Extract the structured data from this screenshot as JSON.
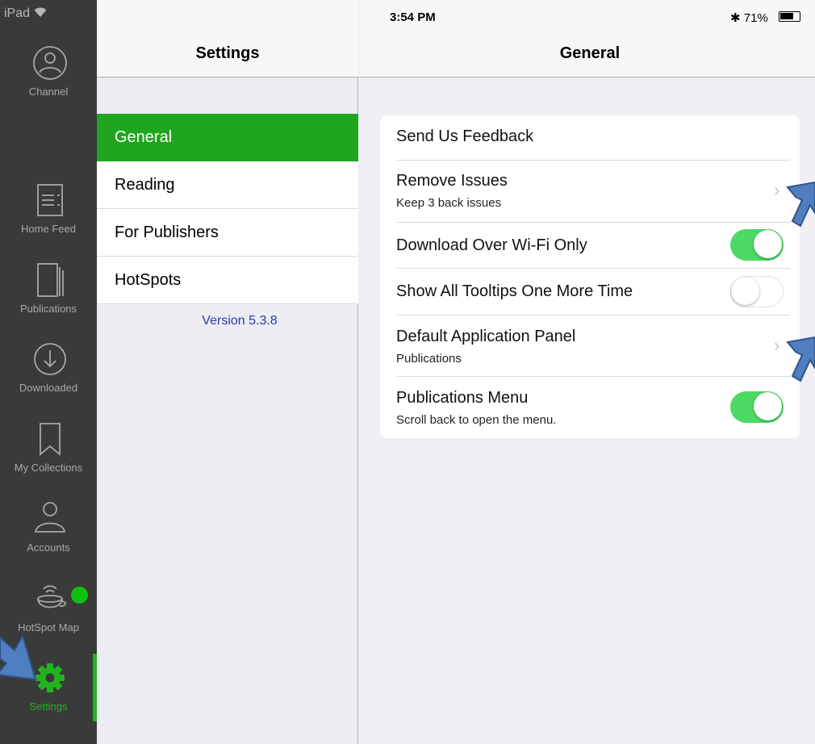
{
  "status_bar": {
    "device": "iPad",
    "time": "3:54 PM",
    "battery": "71%",
    "battery_level": 0.71
  },
  "rail": {
    "items": [
      {
        "label": "Channel",
        "icon": "person-circle-icon"
      },
      {
        "label": "Home Feed",
        "icon": "feed-icon"
      },
      {
        "label": "Publications",
        "icon": "publications-icon"
      },
      {
        "label": "Downloaded",
        "icon": "download-icon"
      },
      {
        "label": "My Collections",
        "icon": "bookmark-icon"
      },
      {
        "label": "Accounts",
        "icon": "person-icon"
      },
      {
        "label": "HotSpot Map",
        "icon": "hotspot-cup-icon"
      },
      {
        "label": "Settings",
        "icon": "gear-icon",
        "active": true
      }
    ],
    "accent": "#22b320"
  },
  "master": {
    "title": "Settings",
    "items": [
      "General",
      "Reading",
      "For Publishers",
      "HotSpots"
    ],
    "selected": "General",
    "version": "Version 5.3.8",
    "selection_color": "#1ea61e"
  },
  "detail": {
    "title": "General",
    "rows": [
      {
        "title": "Send Us Feedback"
      },
      {
        "title": "Remove Issues",
        "subtitle": "Keep 3 back issues",
        "accessory": "chevron"
      },
      {
        "title": "Download Over Wi-Fi Only",
        "toggle": true
      },
      {
        "title": "Show All Tooltips One More Time",
        "toggle": false
      },
      {
        "title": "Default Application Panel",
        "subtitle": "Publications",
        "accessory": "chevron"
      },
      {
        "title": "Publications Menu",
        "subtitle": "Scroll back to open the menu.",
        "toggle": true
      }
    ],
    "toggle_on_color": "#4cd964"
  }
}
